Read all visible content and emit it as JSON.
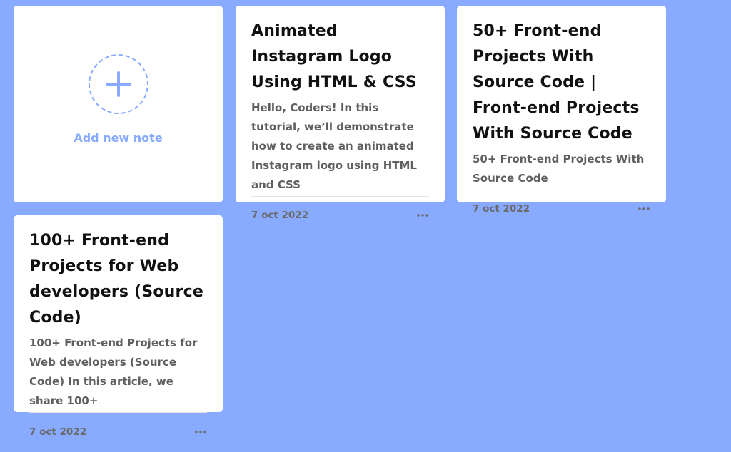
{
  "add_note": {
    "label": "Add new note",
    "icon": "plus-icon"
  },
  "notes": [
    {
      "title": "Animated Instagram Logo Using HTML & CSS",
      "description": "Hello, Coders! In this tutorial, we’ll demonstrate how to create an animated Instagram logo using HTML and CSS",
      "date": "7 oct 2022",
      "menu_icon": "more-horizontal-icon"
    },
    {
      "title": "50+ Front-end Projects With Source Code | Front-end Projects With Source Code",
      "description": "50+ Front-end Projects With Source Code",
      "date": "7 oct 2022",
      "menu_icon": "more-horizontal-icon"
    },
    {
      "title": "100+ Front-end Projects for Web developers (Source Code)",
      "description": "100+ Front-end Projects for Web developers (Source Code) In this article, we share 100+",
      "date": "7 oct 2022",
      "menu_icon": "more-horizontal-icon"
    }
  ],
  "colors": {
    "background": "#88abff",
    "accent": "#88abff",
    "card": "#ffffff",
    "title": "#111111",
    "description": "#5f5f5f"
  }
}
